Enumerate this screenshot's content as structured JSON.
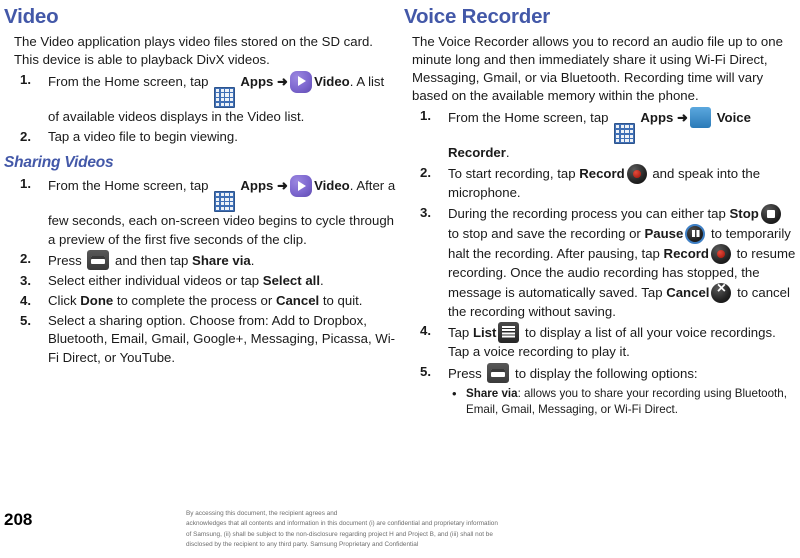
{
  "page_number": "208",
  "left_column": {
    "title": "Video",
    "intro": "The Video application plays video files stored on the SD card. This device is able to playback DivX videos.",
    "steps": [
      {
        "num": "1.",
        "parts": [
          {
            "t": "text",
            "v": "From the Home screen, tap "
          },
          {
            "t": "icon",
            "v": "apps-icon"
          },
          {
            "t": "bold",
            "v": " Apps "
          },
          {
            "t": "arrow",
            "v": "➜"
          },
          {
            "t": "icon",
            "v": "video-icon"
          },
          {
            "t": "bold",
            "v": "Video"
          },
          {
            "t": "text",
            "v": ". A list of available videos displays in the Video list."
          }
        ]
      },
      {
        "num": "2.",
        "parts": [
          {
            "t": "text",
            "v": "Tap a video file to begin viewing."
          }
        ]
      }
    ],
    "subsection": {
      "title": "Sharing Videos",
      "steps": [
        {
          "num": "1.",
          "parts": [
            {
              "t": "text",
              "v": "From the Home screen, tap "
            },
            {
              "t": "icon",
              "v": "apps-icon"
            },
            {
              "t": "bold",
              "v": " Apps "
            },
            {
              "t": "arrow",
              "v": "➜"
            },
            {
              "t": "icon",
              "v": "video-icon"
            },
            {
              "t": "bold",
              "v": "Video"
            },
            {
              "t": "text",
              "v": ". After a few seconds, each on-screen video begins to cycle through a preview of the first five seconds of the clip."
            }
          ]
        },
        {
          "num": "2.",
          "parts": [
            {
              "t": "text",
              "v": "Press "
            },
            {
              "t": "icon",
              "v": "menu-icon"
            },
            {
              "t": "text",
              "v": " and then tap "
            },
            {
              "t": "bold",
              "v": "Share via"
            },
            {
              "t": "text",
              "v": "."
            }
          ]
        },
        {
          "num": "3.",
          "parts": [
            {
              "t": "text",
              "v": "Select either individual videos or tap "
            },
            {
              "t": "bold",
              "v": "Select all"
            },
            {
              "t": "text",
              "v": "."
            }
          ]
        },
        {
          "num": "4.",
          "parts": [
            {
              "t": "text",
              "v": "Click "
            },
            {
              "t": "bold",
              "v": "Done"
            },
            {
              "t": "text",
              "v": " to complete the process or "
            },
            {
              "t": "bold",
              "v": "Cancel"
            },
            {
              "t": "text",
              "v": " to quit."
            }
          ]
        },
        {
          "num": "5.",
          "parts": [
            {
              "t": "text",
              "v": "Select a sharing option. Choose from: Add to Dropbox, Bluetooth, Email, Gmail, Google+, Messaging, Picassa, Wi-Fi Direct, or YouTube."
            }
          ]
        }
      ]
    }
  },
  "right_column": {
    "title": "Voice Recorder",
    "intro": "The Voice Recorder allows you to record an audio file up to one minute long and then immediately share it using Wi-Fi Direct, Messaging, Gmail, or via Bluetooth. Recording time will vary based on the available memory within the phone.",
    "steps": [
      {
        "num": "1.",
        "parts": [
          {
            "t": "text",
            "v": "From the Home screen, tap "
          },
          {
            "t": "icon",
            "v": "apps-icon"
          },
          {
            "t": "bold",
            "v": " Apps "
          },
          {
            "t": "arrow",
            "v": "➜"
          },
          {
            "t": "icon",
            "v": "voice-recorder-icon"
          },
          {
            "t": "bold",
            "v": " Voice Recorder"
          },
          {
            "t": "text",
            "v": "."
          }
        ]
      },
      {
        "num": "2.",
        "parts": [
          {
            "t": "text",
            "v": "To start recording, tap "
          },
          {
            "t": "bold",
            "v": "Record"
          },
          {
            "t": "icon",
            "v": "record-icon"
          },
          {
            "t": "text",
            "v": " and speak into the microphone."
          }
        ]
      },
      {
        "num": "3.",
        "parts": [
          {
            "t": "text",
            "v": "During the recording process you can either tap "
          },
          {
            "t": "bold",
            "v": "Stop"
          },
          {
            "t": "icon",
            "v": "stop-icon"
          },
          {
            "t": "text",
            "v": " to stop and save the recording or "
          },
          {
            "t": "bold",
            "v": "Pause"
          },
          {
            "t": "icon",
            "v": "pause-icon"
          },
          {
            "t": "text",
            "v": " to temporarily halt the recording. After pausing, tap "
          },
          {
            "t": "bold",
            "v": "Record"
          },
          {
            "t": "icon",
            "v": "record-icon"
          },
          {
            "t": "text",
            "v": " to resume recording. Once the audio recording has stopped, the message is automatically saved. Tap "
          },
          {
            "t": "bold",
            "v": "Cancel"
          },
          {
            "t": "icon",
            "v": "cancel-icon"
          },
          {
            "t": "text",
            "v": " to cancel the recording without saving."
          }
        ]
      },
      {
        "num": "4.",
        "parts": [
          {
            "t": "text",
            "v": "Tap "
          },
          {
            "t": "bold",
            "v": "List"
          },
          {
            "t": "icon",
            "v": "list-icon"
          },
          {
            "t": "text",
            "v": " to display a list of all your voice recordings. Tap a voice recording to play it."
          }
        ]
      },
      {
        "num": "5.",
        "parts": [
          {
            "t": "text",
            "v": "Press "
          },
          {
            "t": "icon",
            "v": "menu-icon"
          },
          {
            "t": "text",
            "v": " to display the following options:"
          }
        ],
        "bullets": [
          {
            "parts": [
              {
                "t": "bold",
                "v": "Share via"
              },
              {
                "t": "text",
                "v": ": allows you to share your recording using Bluetooth, Email, Gmail, Messaging, or Wi-Fi Direct."
              }
            ]
          }
        ]
      }
    ]
  },
  "footer": {
    "legal_lines": [
      "By accessing this document, the recipient agrees and",
      "acknowledges that all contents and information in this document (i) are confidential and proprietary information",
      "of Samsung, (ii) shall be subject to the non-disclosure regarding project H and Project B, and (iii) shall not be",
      "disclosed by the recipient to any third party. Samsung Proprietary and Confidential"
    ]
  },
  "colors": {
    "heading": "#4358a8",
    "body": "#1a1a1a",
    "footer_text": "#6e6e6e",
    "apps_icon": "#3f6fb5",
    "video_icon": "#7d67cf",
    "record_dot": "#c32a1c"
  }
}
